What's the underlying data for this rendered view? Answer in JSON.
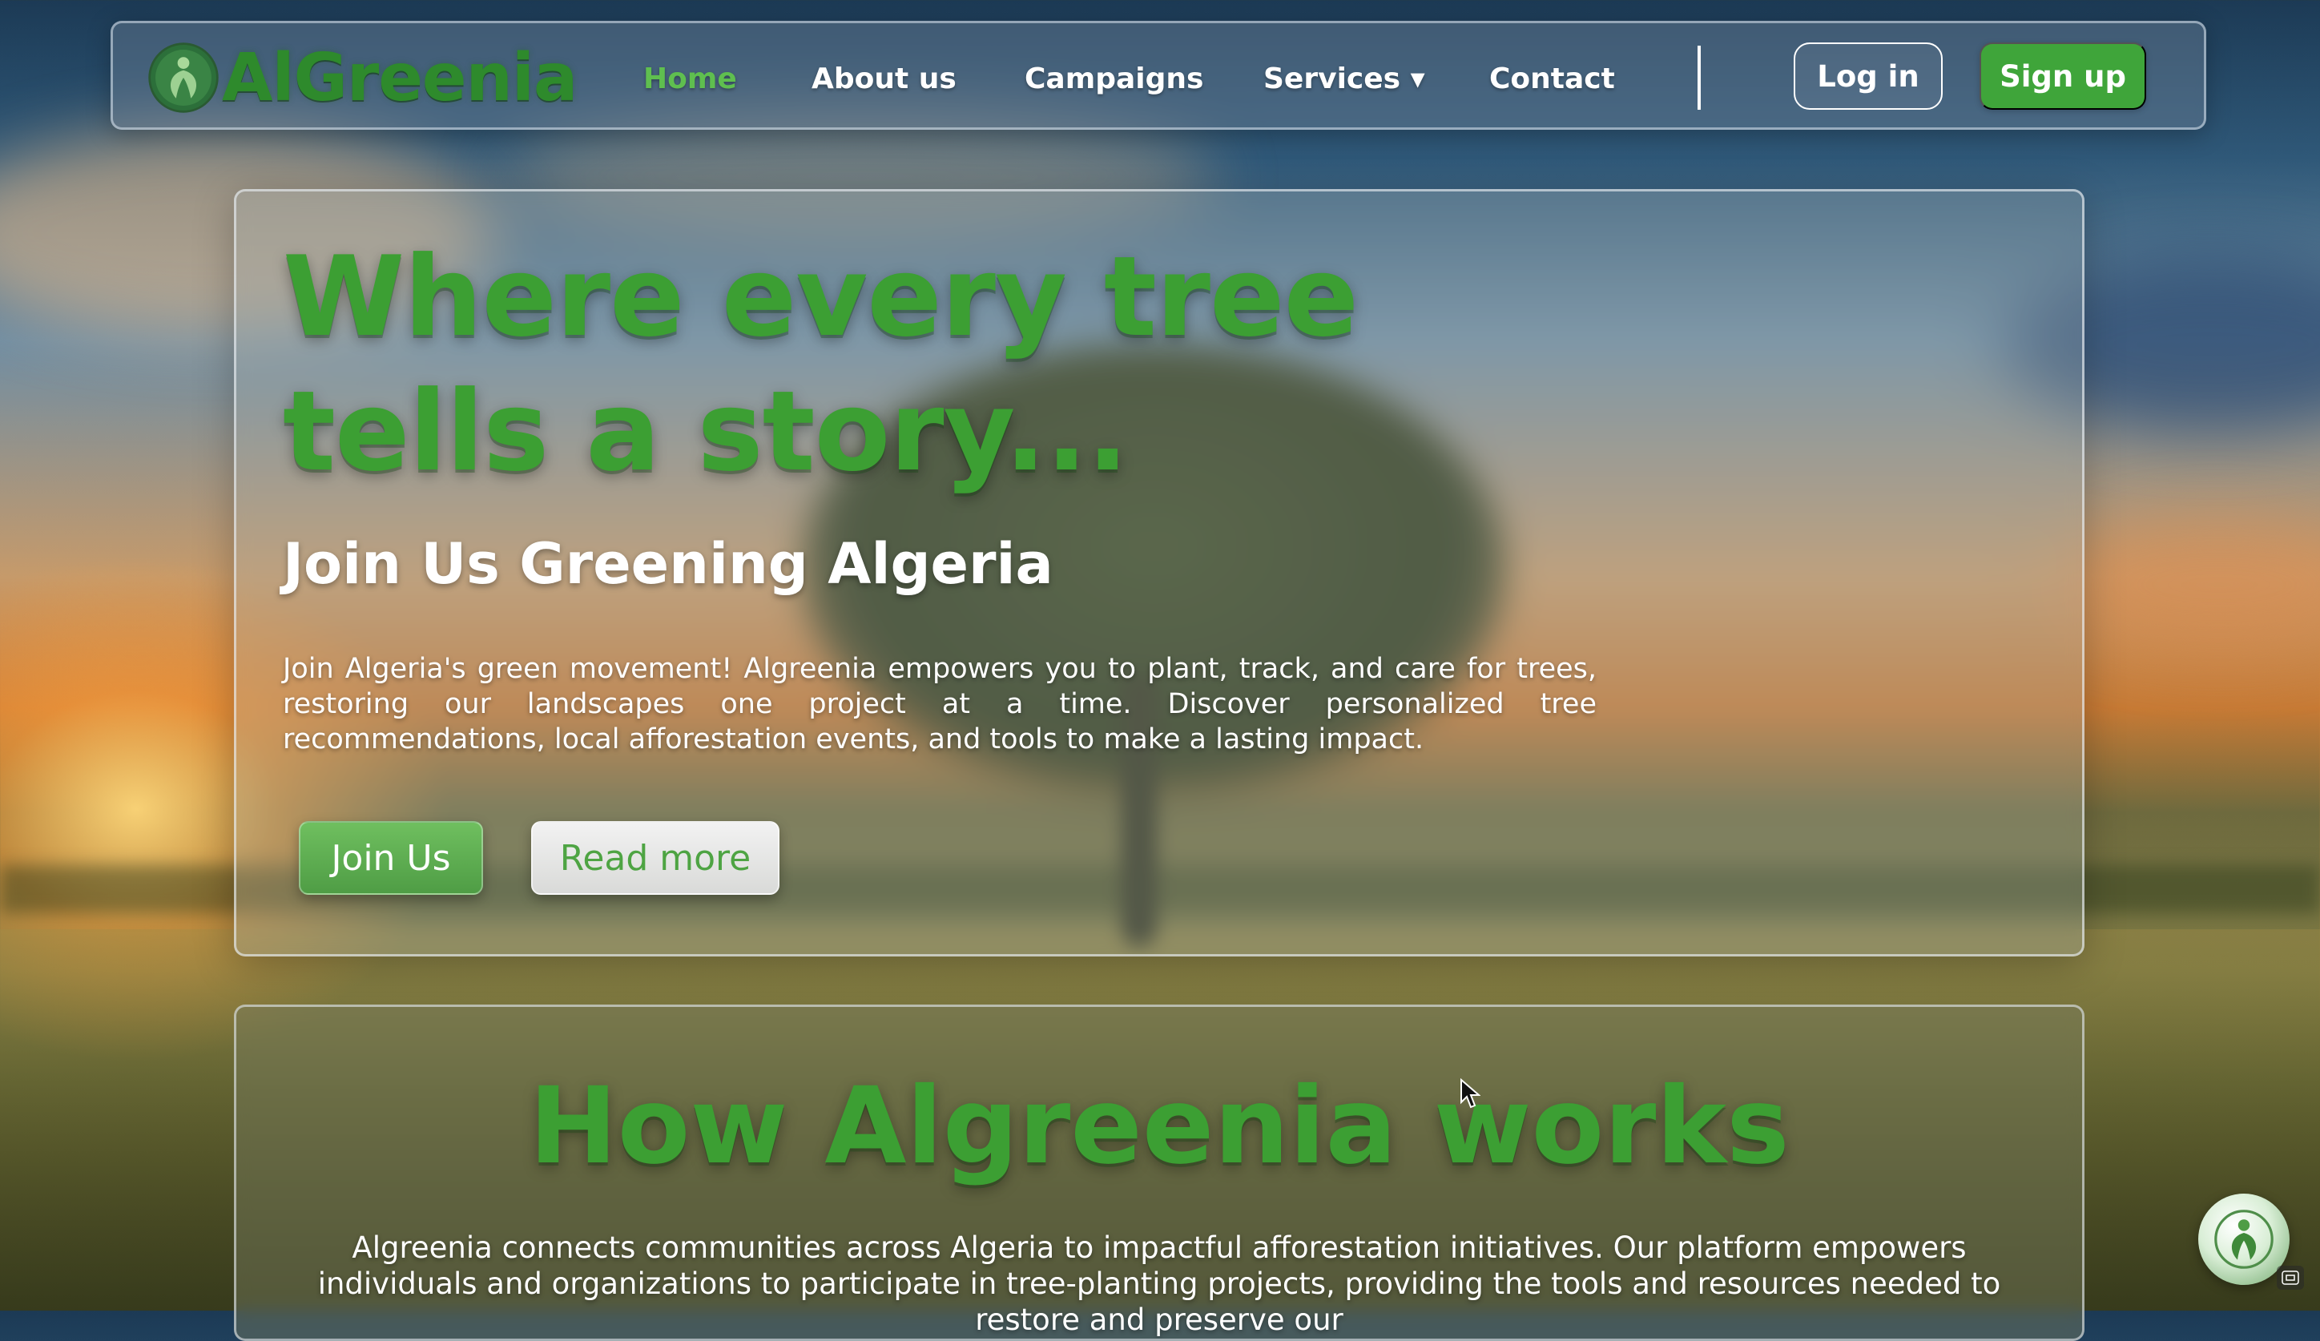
{
  "brand": {
    "name": "AlGreenia",
    "logo_icon": "tree-person-leaf-icon"
  },
  "nav": {
    "links": [
      {
        "label": "Home",
        "active": true
      },
      {
        "label": "About us",
        "active": false
      },
      {
        "label": "Campaigns",
        "active": false
      },
      {
        "label": "Services ▾",
        "active": false
      },
      {
        "label": "Contact",
        "active": false
      }
    ],
    "login_label": "Log in",
    "signup_label": "Sign up"
  },
  "hero": {
    "title": "Where every tree tells a story...",
    "subtitle": "Join Us Greening Algeria",
    "text": "Join Algeria's green movement! Algreenia empowers you to plant, track, and care for trees, restoring our landscapes one project at a time. Discover personalized tree recommendations, local afforestation events, and tools to make a lasting impact.",
    "join_label": "Join Us",
    "readmore_label": "Read more"
  },
  "how": {
    "title": "How Algreenia works",
    "text": "Algreenia connects communities across Algeria to impactful afforestation initiatives. Our platform empowers individuals and organizations to participate in tree-planting projects, providing the tools and resources needed to restore and preserve our"
  },
  "colors": {
    "brand_green": "#3c9f33",
    "active_nav": "#5fbf4f",
    "signup_bg": "#3fa53a"
  },
  "icons": {
    "chat_widget": "assistant-tree-icon",
    "mini": "screenshot-icon",
    "cursor": "mouse-pointer-icon"
  }
}
